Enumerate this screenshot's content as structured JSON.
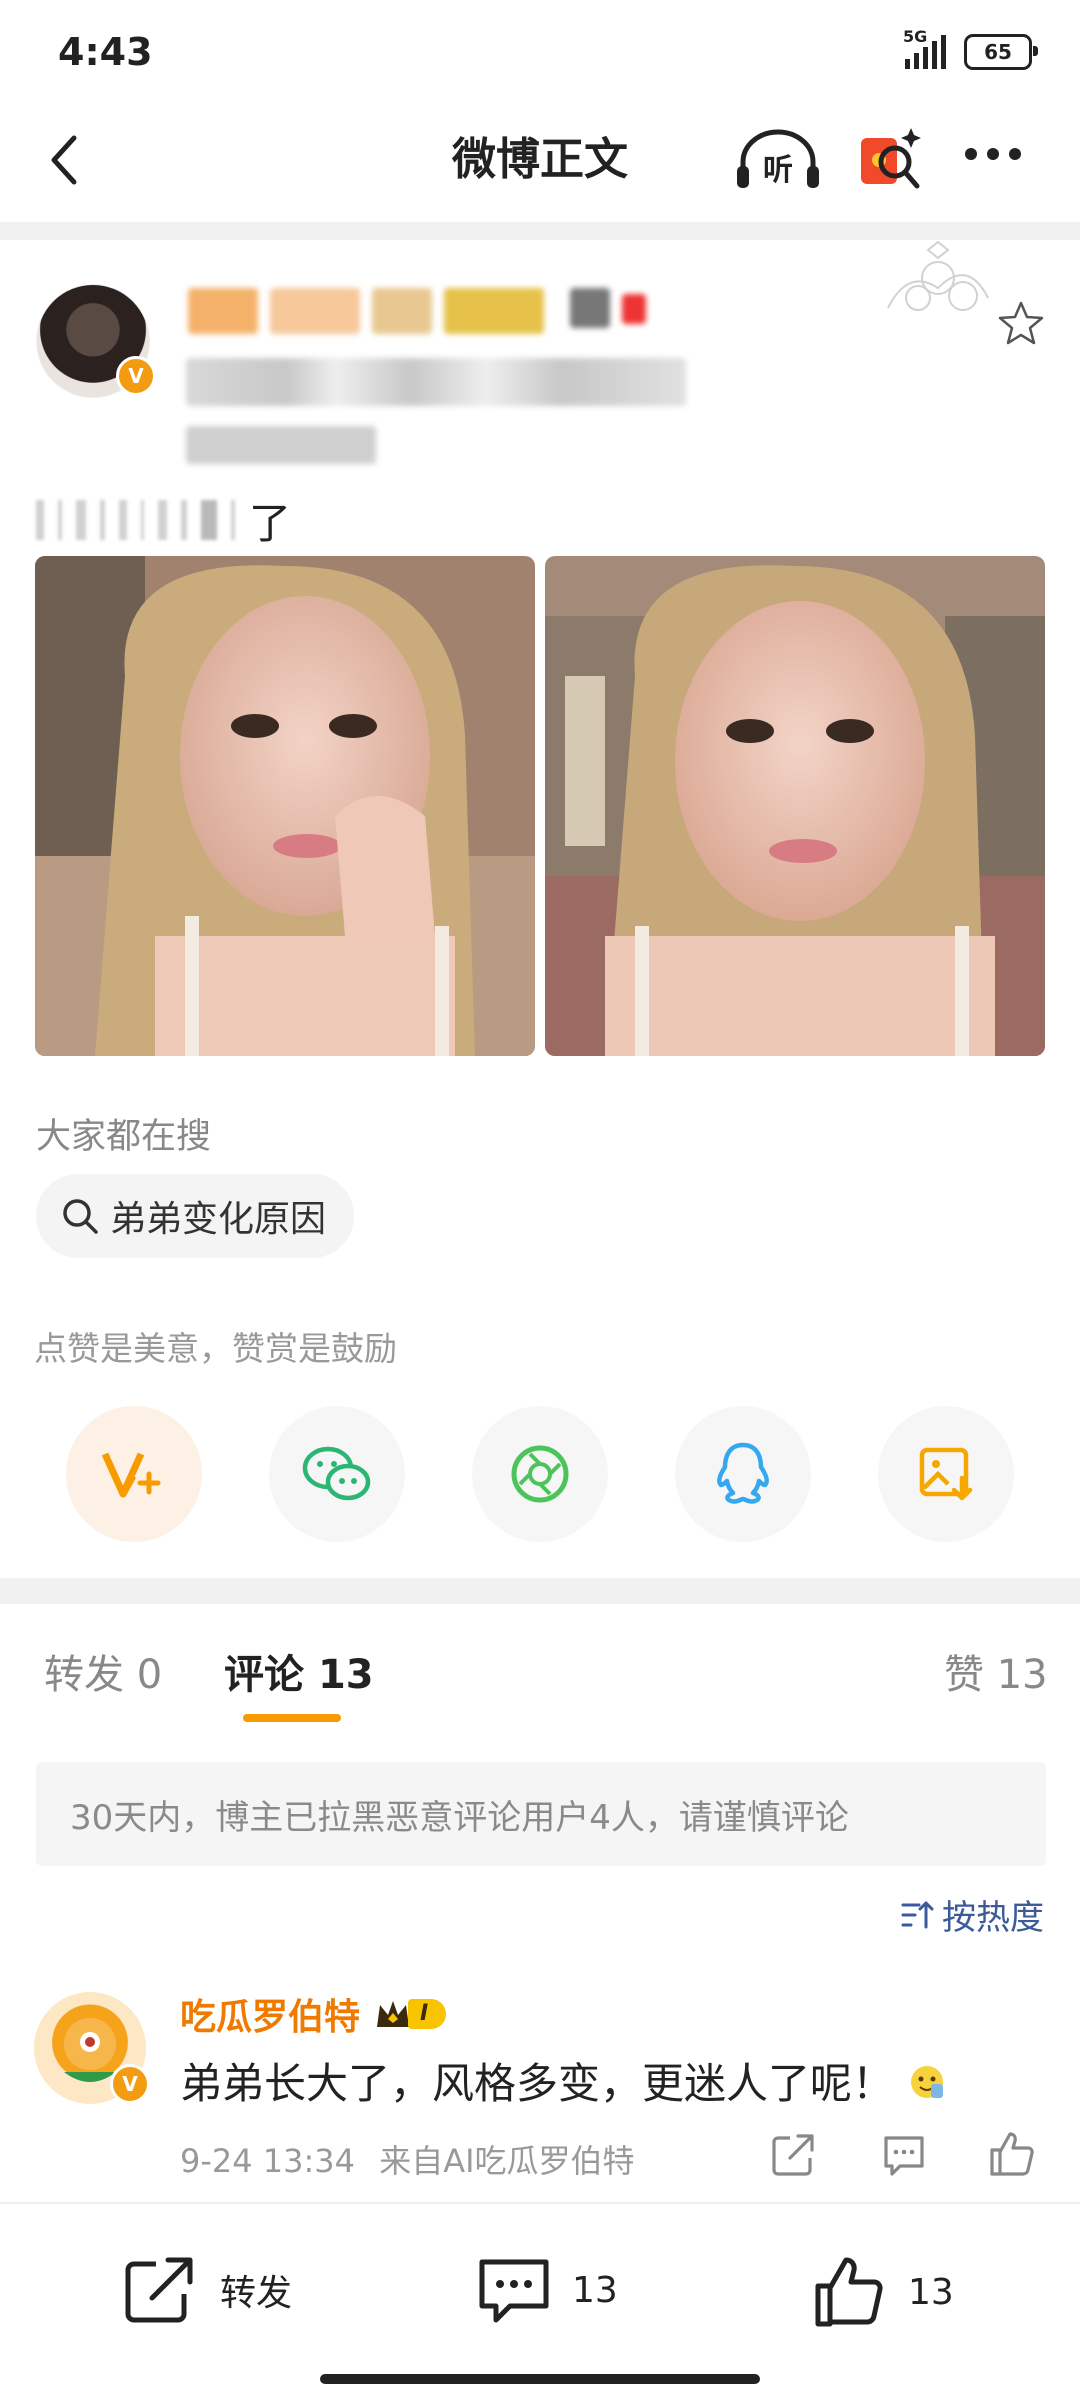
{
  "status_bar": {
    "time": "4:43",
    "network": "5G",
    "battery": "65"
  },
  "nav": {
    "title": "微博正文",
    "listen_label": "听"
  },
  "post": {
    "text_end": "了"
  },
  "search": {
    "title": "大家都在搜",
    "query": "弟弟变化原因"
  },
  "reward": {
    "text": "点赞是美意，赞赏是鼓励"
  },
  "share_icons": [
    "v-plus-icon",
    "wechat-icon",
    "moments-icon",
    "qq-icon",
    "save-image-icon"
  ],
  "tabs": {
    "repost": {
      "label": "转发",
      "count": "0"
    },
    "comment": {
      "label": "评论",
      "count": "13"
    },
    "like": {
      "label": "赞",
      "count": "13"
    }
  },
  "notice": "30天内，博主已拉黑恶意评论用户4人，请谨慎评论",
  "sort_label": "按热度",
  "comment": {
    "name": "吃瓜罗伯特",
    "badge": "I",
    "text": "弟弟长大了，风格多变，更迷人了呢！",
    "time": "9-24 13:34",
    "source": "来自AI吃瓜罗伯特"
  },
  "bottom_bar": {
    "repost_label": "转发",
    "comment_count": "13",
    "like_count": "13"
  },
  "colors": {
    "accent": "#f79b00",
    "name_orange": "#f07a00",
    "link_blue": "#3a5a9a"
  }
}
